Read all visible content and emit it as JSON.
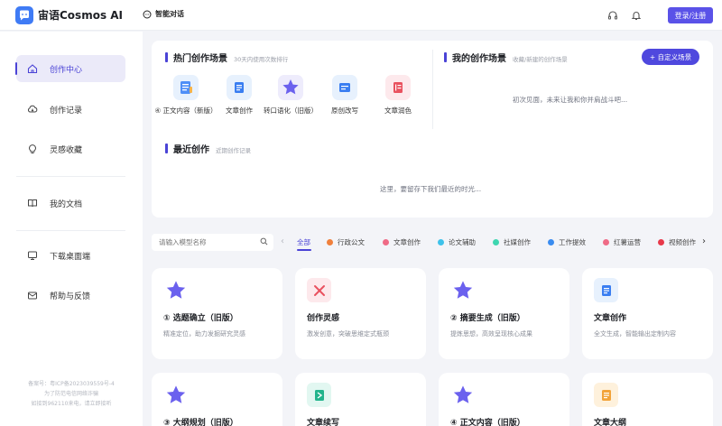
{
  "header": {
    "app_name": "宙语Cosmos AI",
    "nav_chat": "智能对话",
    "login_label": "登录/注册"
  },
  "sidebar": {
    "items": [
      {
        "label": "创作中心",
        "icon": "home-icon"
      },
      {
        "label": "创作记录",
        "icon": "cloud-icon"
      },
      {
        "label": "灵感收藏",
        "icon": "lightbulb-icon"
      },
      {
        "label": "我的文档",
        "icon": "book-icon"
      },
      {
        "label": "下载桌面端",
        "icon": "monitor-icon"
      },
      {
        "label": "帮助与反馈",
        "icon": "mail-icon"
      }
    ],
    "footer": [
      "备案号：粤ICP备2023039559号-4",
      "为了防范电信网络诈骗",
      "如接到962110来电，请立即接听"
    ]
  },
  "hot_scenes": {
    "title": "热门创作场景",
    "subtitle": "30天内使用次数排行",
    "items": [
      {
        "label": "④ 正文内容（新版）",
        "icon": "document-sketch-icon"
      },
      {
        "label": "文章创作",
        "icon": "article-icon"
      },
      {
        "label": "转口语化（旧版）",
        "icon": "star-icon"
      },
      {
        "label": "原创改写",
        "icon": "rewrite-icon"
      },
      {
        "label": "文章润色",
        "icon": "polish-icon"
      }
    ]
  },
  "my_scenes": {
    "title": "我的创作场景",
    "subtitle": "收藏/新建的创作场景",
    "button": "+ 自定义场景",
    "empty": "初次见面，未来让我和你并肩战斗吧..."
  },
  "recent": {
    "title": "最近创作",
    "subtitle": "近期创作记录",
    "empty": "这里，要留存下我们最近的时光..."
  },
  "filter": {
    "search_placeholder": "请输入模型名称",
    "prev": "‹",
    "next": "›",
    "categories": [
      {
        "label": "全部",
        "color": ""
      },
      {
        "label": "行政公文",
        "color": "#f0803c"
      },
      {
        "label": "文章创作",
        "color": "#ef6b86"
      },
      {
        "label": "论文辅助",
        "color": "#3ec2ea"
      },
      {
        "label": "社媒创作",
        "color": "#3ed6b0"
      },
      {
        "label": "工作提效",
        "color": "#3a8cf0"
      },
      {
        "label": "红薯运营",
        "color": "#ef6b86"
      },
      {
        "label": "视频创作",
        "color": "#e8394a"
      }
    ]
  },
  "cards": [
    {
      "title": "① 选题确立（旧版）",
      "desc": "精准定位，助力发掘研究灵感",
      "icon": "star-icon"
    },
    {
      "title": "创作灵感",
      "desc": "激发创意，突破思维定式瓶颈",
      "icon": "inspiration-icon"
    },
    {
      "title": "② 摘要生成（旧版）",
      "desc": "提炼思想，高效呈现核心成果",
      "icon": "star-icon"
    },
    {
      "title": "文章创作",
      "desc": "全文生成，智能输出定制内容",
      "icon": "article-icon"
    },
    {
      "title": "③ 大纲规划（旧版）",
      "desc": "",
      "icon": "star-icon"
    },
    {
      "title": "文章续写",
      "desc": "",
      "icon": "continue-icon"
    },
    {
      "title": "④ 正文内容（旧版）",
      "desc": "",
      "icon": "star-icon"
    },
    {
      "title": "文章大纲",
      "desc": "",
      "icon": "outline-icon"
    }
  ]
}
